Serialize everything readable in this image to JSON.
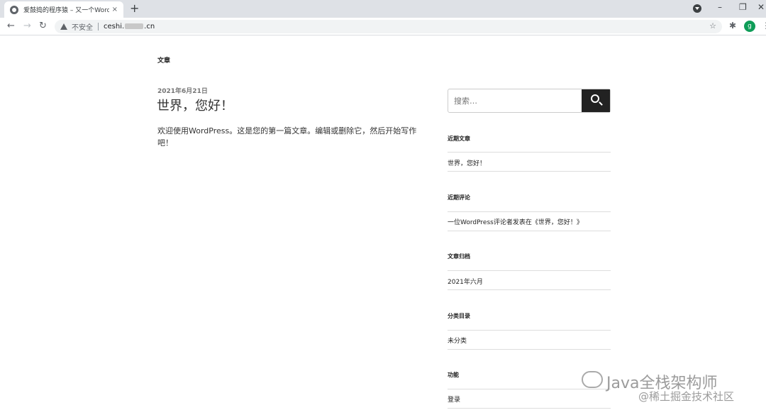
{
  "browser": {
    "tab_title": "爱鼓捣的程序猿 – 又一个WordP",
    "tab_close": "×",
    "new_tab": "+",
    "insecure_label": "不安全",
    "url_prefix": "ceshi.",
    "url_suffix": ".cn",
    "avatar_letter": "g"
  },
  "page": {
    "breadcrumb": "文章",
    "post": {
      "date": "2021年6月21日",
      "title": "世界，您好！",
      "body": "欢迎使用WordPress。这是您的第一篇文章。编辑或删除它，然后开始写作吧！"
    },
    "search": {
      "placeholder": "搜索…"
    },
    "widgets": [
      {
        "title": "近期文章",
        "link": "世界，您好！"
      },
      {
        "title": "近期评论",
        "link": "一位WordPress评论者发表在《世界，您好！》"
      },
      {
        "title": "文章归档",
        "link": "2021年六月"
      },
      {
        "title": "分类目录",
        "link": "未分类"
      },
      {
        "title": "功能",
        "link": "登录"
      }
    ]
  },
  "watermark": {
    "main": "Java全栈架构师",
    "sub": "@稀土掘金技术社区"
  }
}
